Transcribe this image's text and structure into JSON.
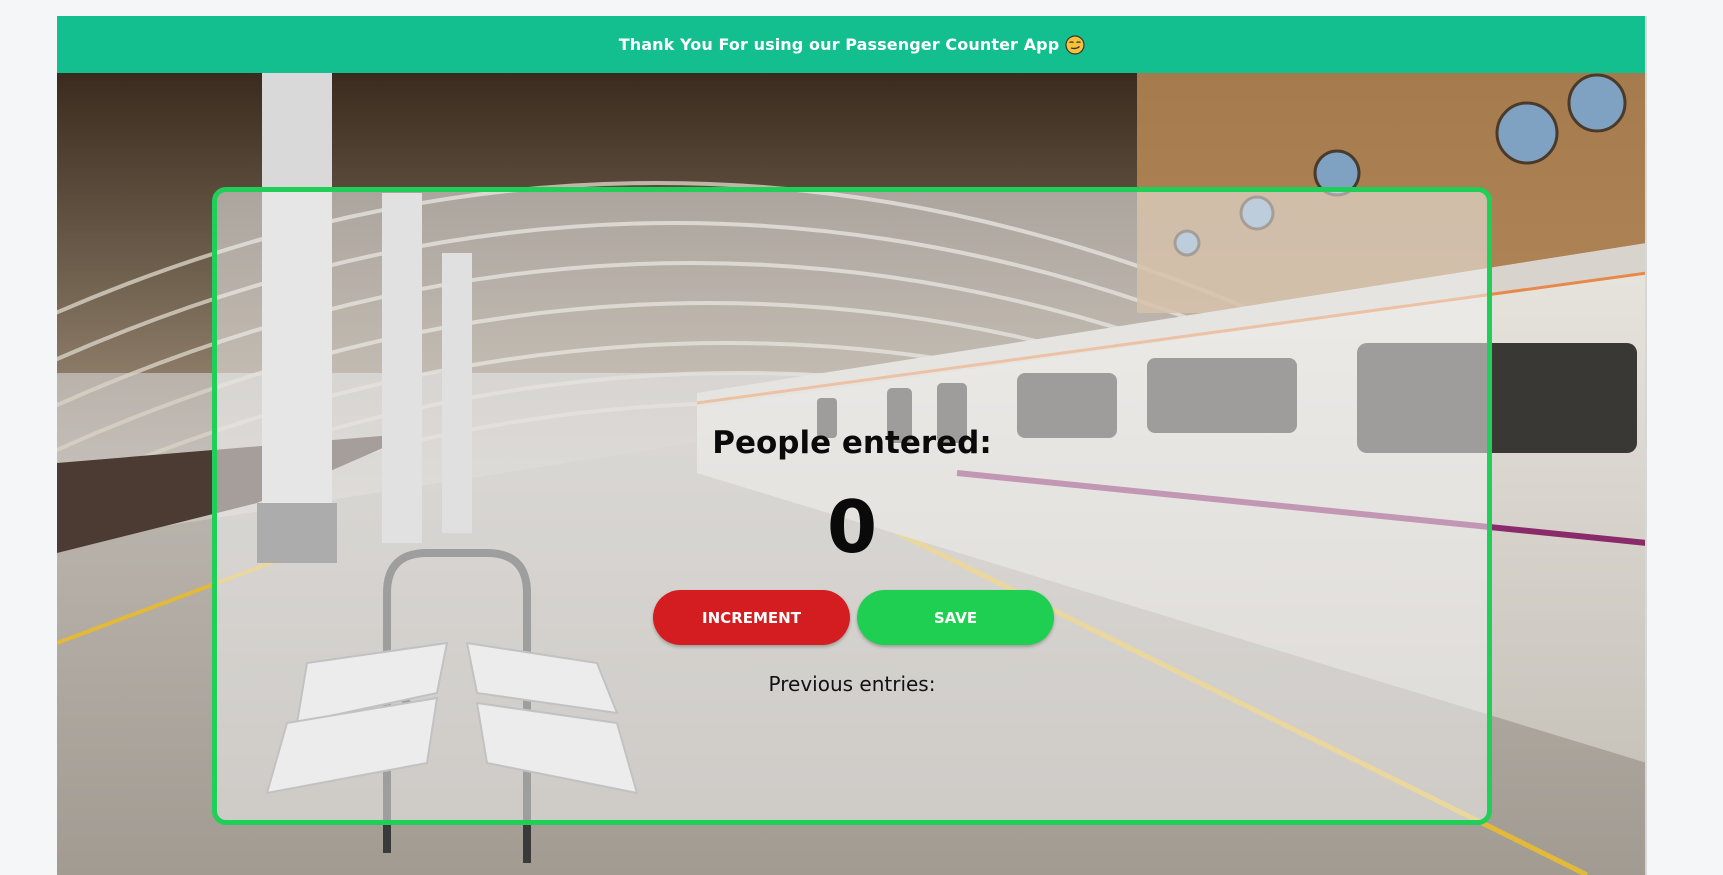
{
  "banner": {
    "text": "Thank You For using our Passenger Counter App",
    "emoji_icon": "smirk-face-emoji-icon",
    "background_color": "#13bf8e"
  },
  "background": {
    "description_icon": "train-station-photo"
  },
  "counter": {
    "title": "People entered:",
    "value": "0",
    "increment_label": "INCREMENT",
    "save_label": "SAVE",
    "previous_label": "Previous entries:",
    "previous_entries": ""
  },
  "colors": {
    "card_border": "#1fcf57",
    "increment_button": "#d41d20",
    "save_button": "#1ecf52"
  }
}
